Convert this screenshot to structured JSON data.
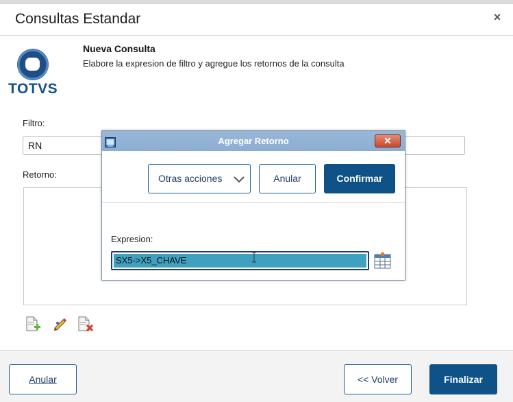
{
  "window": {
    "title": "Consultas Estandar"
  },
  "logo": {
    "text": "TOTVS",
    "brand_color": "#16508a"
  },
  "wizard": {
    "step_title": "Nueva Consulta",
    "step_subtitle": "Elabore la expresion de filtro y agregue los retornos de la consulta"
  },
  "filtro": {
    "label": "Filtro:",
    "value": "RN"
  },
  "retorno": {
    "label": "Retorno:"
  },
  "tools": {
    "add": "add-document-icon",
    "edit": "edit-pencil-icon",
    "delete": "delete-document-icon"
  },
  "footer": {
    "anular": "Anular",
    "volver": "<< Volver",
    "finalizar": "Finalizar"
  },
  "dialog": {
    "title": "Agregar Retorno",
    "close_glyph": "✕",
    "more_actions": "Otras acciones",
    "cancel": "Anular",
    "confirm": "Confirmar",
    "expr_label": "Expresion:",
    "expr_value": "SX5->X5_CHAVE"
  },
  "colors": {
    "primary": "#0f5288",
    "outline": "#1d5f96",
    "titlebar": "#8daed3",
    "selection": "#3fa1bf"
  }
}
